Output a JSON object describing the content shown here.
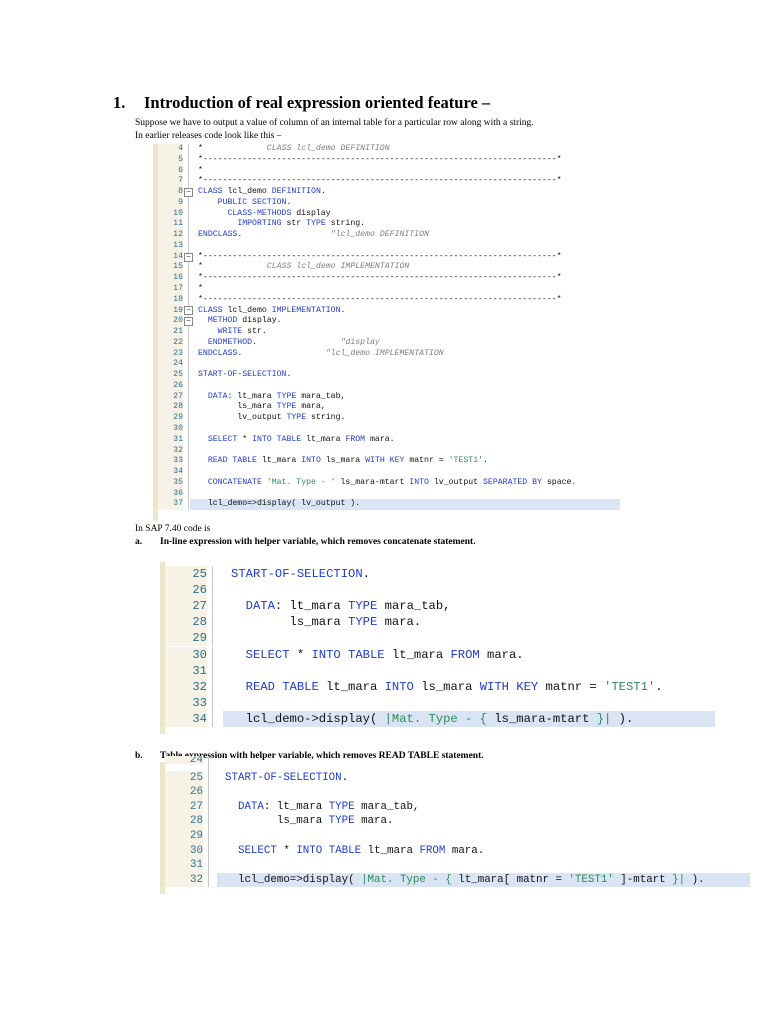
{
  "heading": {
    "number": "1.",
    "title": "Introduction of real expression oriented feature –"
  },
  "intro": {
    "line1": "Suppose we have to output a value of column of an internal table for a particular row along with a string.",
    "line2": "In earlier releases code look like this –"
  },
  "sap_label": "In SAP 7.40 code is",
  "section_a": {
    "letter": "a.",
    "text": "In-line expression with helper variable, which removes concatenate statement."
  },
  "section_b": {
    "letter": "b.",
    "text": "Table expression with helper variable, which removes READ TABLE statement."
  },
  "colors": {
    "keyword": "#1f3bd1",
    "string": "#2e8b57",
    "comment": "#7f7f7f",
    "line_number": "#2f6f89",
    "highlight": "#d9e4f5",
    "gutter": "#f6f3e6"
  },
  "code_blocks": [
    {
      "name": "code-block-old",
      "lines": [
        {
          "no": "4",
          "tokens": [
            [
              "tx",
              "*             "
            ],
            [
              "cm",
              "CLASS lcl_demo DEFINITION"
            ]
          ]
        },
        {
          "no": "5",
          "tokens": [
            [
              "tx",
              "*------------------------------------------------------------------------*"
            ]
          ]
        },
        {
          "no": "6",
          "tokens": [
            [
              "tx",
              "*"
            ]
          ]
        },
        {
          "no": "7",
          "tokens": [
            [
              "tx",
              "*------------------------------------------------------------------------*"
            ]
          ]
        },
        {
          "no": "8",
          "fold": true,
          "tokens": [
            [
              "kw",
              "CLASS"
            ],
            [
              "tx",
              " lcl_demo "
            ],
            [
              "kw",
              "DEFINITION"
            ],
            [
              "tx",
              "."
            ]
          ]
        },
        {
          "no": "9",
          "tokens": [
            [
              "tx",
              "    "
            ],
            [
              "kw",
              "PUBLIC SECTION"
            ],
            [
              "tx",
              "."
            ]
          ]
        },
        {
          "no": "10",
          "tokens": [
            [
              "tx",
              "      "
            ],
            [
              "kw",
              "CLASS-METHODS"
            ],
            [
              "tx",
              " display"
            ]
          ]
        },
        {
          "no": "11",
          "tokens": [
            [
              "tx",
              "        "
            ],
            [
              "kw",
              "IMPORTING"
            ],
            [
              "tx",
              " str "
            ],
            [
              "kw",
              "TYPE"
            ],
            [
              "tx",
              " string."
            ]
          ]
        },
        {
          "no": "12",
          "tokens": [
            [
              "kw",
              "ENDCLASS"
            ],
            [
              "tx",
              ".                  "
            ],
            [
              "cm",
              "\"lcl_demo DEFINITION"
            ]
          ]
        },
        {
          "no": "13",
          "tokens": []
        },
        {
          "no": "14",
          "fold": true,
          "tokens": [
            [
              "tx",
              "*------------------------------------------------------------------------*"
            ]
          ]
        },
        {
          "no": "15",
          "tokens": [
            [
              "tx",
              "*             "
            ],
            [
              "cm",
              "CLASS lcl_demo IMPLEMENTATION"
            ]
          ]
        },
        {
          "no": "16",
          "tokens": [
            [
              "tx",
              "*------------------------------------------------------------------------*"
            ]
          ]
        },
        {
          "no": "17",
          "tokens": [
            [
              "tx",
              "*"
            ]
          ]
        },
        {
          "no": "18",
          "tokens": [
            [
              "tx",
              "*------------------------------------------------------------------------*"
            ]
          ]
        },
        {
          "no": "19",
          "fold": true,
          "tokens": [
            [
              "kw",
              "CLASS"
            ],
            [
              "tx",
              " lcl_demo "
            ],
            [
              "kw",
              "IMPLEMENTATION"
            ],
            [
              "tx",
              "."
            ]
          ]
        },
        {
          "no": "20",
          "fold": true,
          "tokens": [
            [
              "tx",
              "  "
            ],
            [
              "kw",
              "METHOD"
            ],
            [
              "tx",
              " display."
            ]
          ]
        },
        {
          "no": "21",
          "tokens": [
            [
              "tx",
              "    "
            ],
            [
              "kw",
              "WRITE"
            ],
            [
              "tx",
              " str."
            ]
          ]
        },
        {
          "no": "22",
          "tokens": [
            [
              "tx",
              "  "
            ],
            [
              "kw",
              "ENDMETHOD"
            ],
            [
              "tx",
              ".                 "
            ],
            [
              "cm",
              "\"display"
            ]
          ]
        },
        {
          "no": "23",
          "tokens": [
            [
              "kw",
              "ENDCLASS"
            ],
            [
              "tx",
              ".                 "
            ],
            [
              "cm",
              "\"lcl_demo IMPLEMENTATION"
            ]
          ]
        },
        {
          "no": "24",
          "tokens": []
        },
        {
          "no": "25",
          "tokens": [
            [
              "kw",
              "START-OF-SELECTION"
            ],
            [
              "tx",
              "."
            ]
          ]
        },
        {
          "no": "26",
          "tokens": []
        },
        {
          "no": "27",
          "tokens": [
            [
              "tx",
              "  "
            ],
            [
              "kw",
              "DATA"
            ],
            [
              "tx",
              ": lt_mara "
            ],
            [
              "kw",
              "TYPE"
            ],
            [
              "tx",
              " mara_tab,"
            ]
          ]
        },
        {
          "no": "28",
          "tokens": [
            [
              "tx",
              "        ls_mara "
            ],
            [
              "kw",
              "TYPE"
            ],
            [
              "tx",
              " mara,"
            ]
          ]
        },
        {
          "no": "29",
          "tokens": [
            [
              "tx",
              "        lv_output "
            ],
            [
              "kw",
              "TYPE"
            ],
            [
              "tx",
              " string."
            ]
          ]
        },
        {
          "no": "30",
          "tokens": []
        },
        {
          "no": "31",
          "tokens": [
            [
              "tx",
              "  "
            ],
            [
              "kw",
              "SELECT"
            ],
            [
              "tx",
              " * "
            ],
            [
              "kw",
              "INTO TABLE"
            ],
            [
              "tx",
              " lt_mara "
            ],
            [
              "kw",
              "FROM"
            ],
            [
              "tx",
              " mara."
            ]
          ]
        },
        {
          "no": "32",
          "tokens": []
        },
        {
          "no": "33",
          "tokens": [
            [
              "tx",
              "  "
            ],
            [
              "kw",
              "READ TABLE"
            ],
            [
              "tx",
              " lt_mara "
            ],
            [
              "kw",
              "INTO"
            ],
            [
              "tx",
              " ls_mara "
            ],
            [
              "kw",
              "WITH KEY"
            ],
            [
              "tx",
              " matnr = "
            ],
            [
              "str",
              "'TEST1'"
            ],
            [
              "tx",
              "."
            ]
          ]
        },
        {
          "no": "34",
          "tokens": []
        },
        {
          "no": "35",
          "tokens": [
            [
              "tx",
              "  "
            ],
            [
              "kw",
              "CONCATENATE"
            ],
            [
              "tx",
              " "
            ],
            [
              "str",
              "'Mat. Type - '"
            ],
            [
              "tx",
              " ls_mara-mtart "
            ],
            [
              "kw",
              "INTO"
            ],
            [
              "tx",
              " lv_output "
            ],
            [
              "kw",
              "SEPARATED BY"
            ],
            [
              "tx",
              " space."
            ]
          ]
        },
        {
          "no": "36",
          "tokens": []
        },
        {
          "no": "37",
          "highlight": true,
          "tokens": [
            [
              "tx",
              "  lcl_demo=>display( lv_output )."
            ]
          ]
        }
      ]
    },
    {
      "name": "code-block-a",
      "lines": [
        {
          "no": "25",
          "tokens": [
            [
              "kw",
              "START-OF-SELECTION"
            ],
            [
              "tx",
              "."
            ]
          ]
        },
        {
          "no": "26",
          "tokens": []
        },
        {
          "no": "27",
          "tokens": [
            [
              "tx",
              "  "
            ],
            [
              "kw",
              "DATA"
            ],
            [
              "tx",
              ": lt_mara "
            ],
            [
              "kw",
              "TYPE"
            ],
            [
              "tx",
              " mara_tab,"
            ]
          ]
        },
        {
          "no": "28",
          "tokens": [
            [
              "tx",
              "        ls_mara "
            ],
            [
              "kw",
              "TYPE"
            ],
            [
              "tx",
              " mara."
            ]
          ]
        },
        {
          "no": "29",
          "tokens": []
        },
        {
          "no": "30",
          "tokens": [
            [
              "tx",
              "  "
            ],
            [
              "kw",
              "SELECT"
            ],
            [
              "tx",
              " * "
            ],
            [
              "kw",
              "INTO TABLE"
            ],
            [
              "tx",
              " lt_mara "
            ],
            [
              "kw",
              "FROM"
            ],
            [
              "tx",
              " mara."
            ]
          ]
        },
        {
          "no": "31",
          "tokens": []
        },
        {
          "no": "32",
          "tokens": [
            [
              "tx",
              "  "
            ],
            [
              "kw",
              "READ TABLE"
            ],
            [
              "tx",
              " lt_mara "
            ],
            [
              "kw",
              "INTO"
            ],
            [
              "tx",
              " ls_mara "
            ],
            [
              "kw",
              "WITH KEY"
            ],
            [
              "tx",
              " matnr = "
            ],
            [
              "str",
              "'TEST1'"
            ],
            [
              "tx",
              "."
            ]
          ]
        },
        {
          "no": "33",
          "tokens": []
        },
        {
          "no": "34",
          "highlight": true,
          "tokens": [
            [
              "tx",
              "  lcl_demo->display( "
            ],
            [
              "str",
              "|Mat. Type - { "
            ],
            [
              "tx",
              "ls_mara-mtart"
            ],
            [
              "str",
              " }|"
            ],
            [
              "tx",
              " )."
            ]
          ]
        }
      ]
    },
    {
      "name": "code-block-b",
      "lines": [
        {
          "no": "24",
          "partial": true,
          "tokens": []
        },
        {
          "no": "25",
          "tokens": [
            [
              "kw",
              "START-OF-SELECTION"
            ],
            [
              "tx",
              "."
            ]
          ]
        },
        {
          "no": "26",
          "tokens": []
        },
        {
          "no": "27",
          "tokens": [
            [
              "tx",
              "  "
            ],
            [
              "kw",
              "DATA"
            ],
            [
              "tx",
              ": lt_mara "
            ],
            [
              "kw",
              "TYPE"
            ],
            [
              "tx",
              " mara_tab,"
            ]
          ]
        },
        {
          "no": "28",
          "tokens": [
            [
              "tx",
              "        ls_mara "
            ],
            [
              "kw",
              "TYPE"
            ],
            [
              "tx",
              " mara."
            ]
          ]
        },
        {
          "no": "29",
          "tokens": []
        },
        {
          "no": "30",
          "tokens": [
            [
              "tx",
              "  "
            ],
            [
              "kw",
              "SELECT"
            ],
            [
              "tx",
              " * "
            ],
            [
              "kw",
              "INTO TABLE"
            ],
            [
              "tx",
              " lt_mara "
            ],
            [
              "kw",
              "FROM"
            ],
            [
              "tx",
              " mara."
            ]
          ]
        },
        {
          "no": "31",
          "tokens": []
        },
        {
          "no": "32",
          "highlight": true,
          "tokens": [
            [
              "tx",
              "  lcl_demo=>display( "
            ],
            [
              "str",
              "|Mat. Type - { "
            ],
            [
              "tx",
              "lt_mara[ matnr = "
            ],
            [
              "str",
              "'TEST1'"
            ],
            [
              "tx",
              " ]-mtart"
            ],
            [
              "str",
              " }|"
            ],
            [
              "tx",
              " )."
            ]
          ]
        }
      ]
    }
  ]
}
